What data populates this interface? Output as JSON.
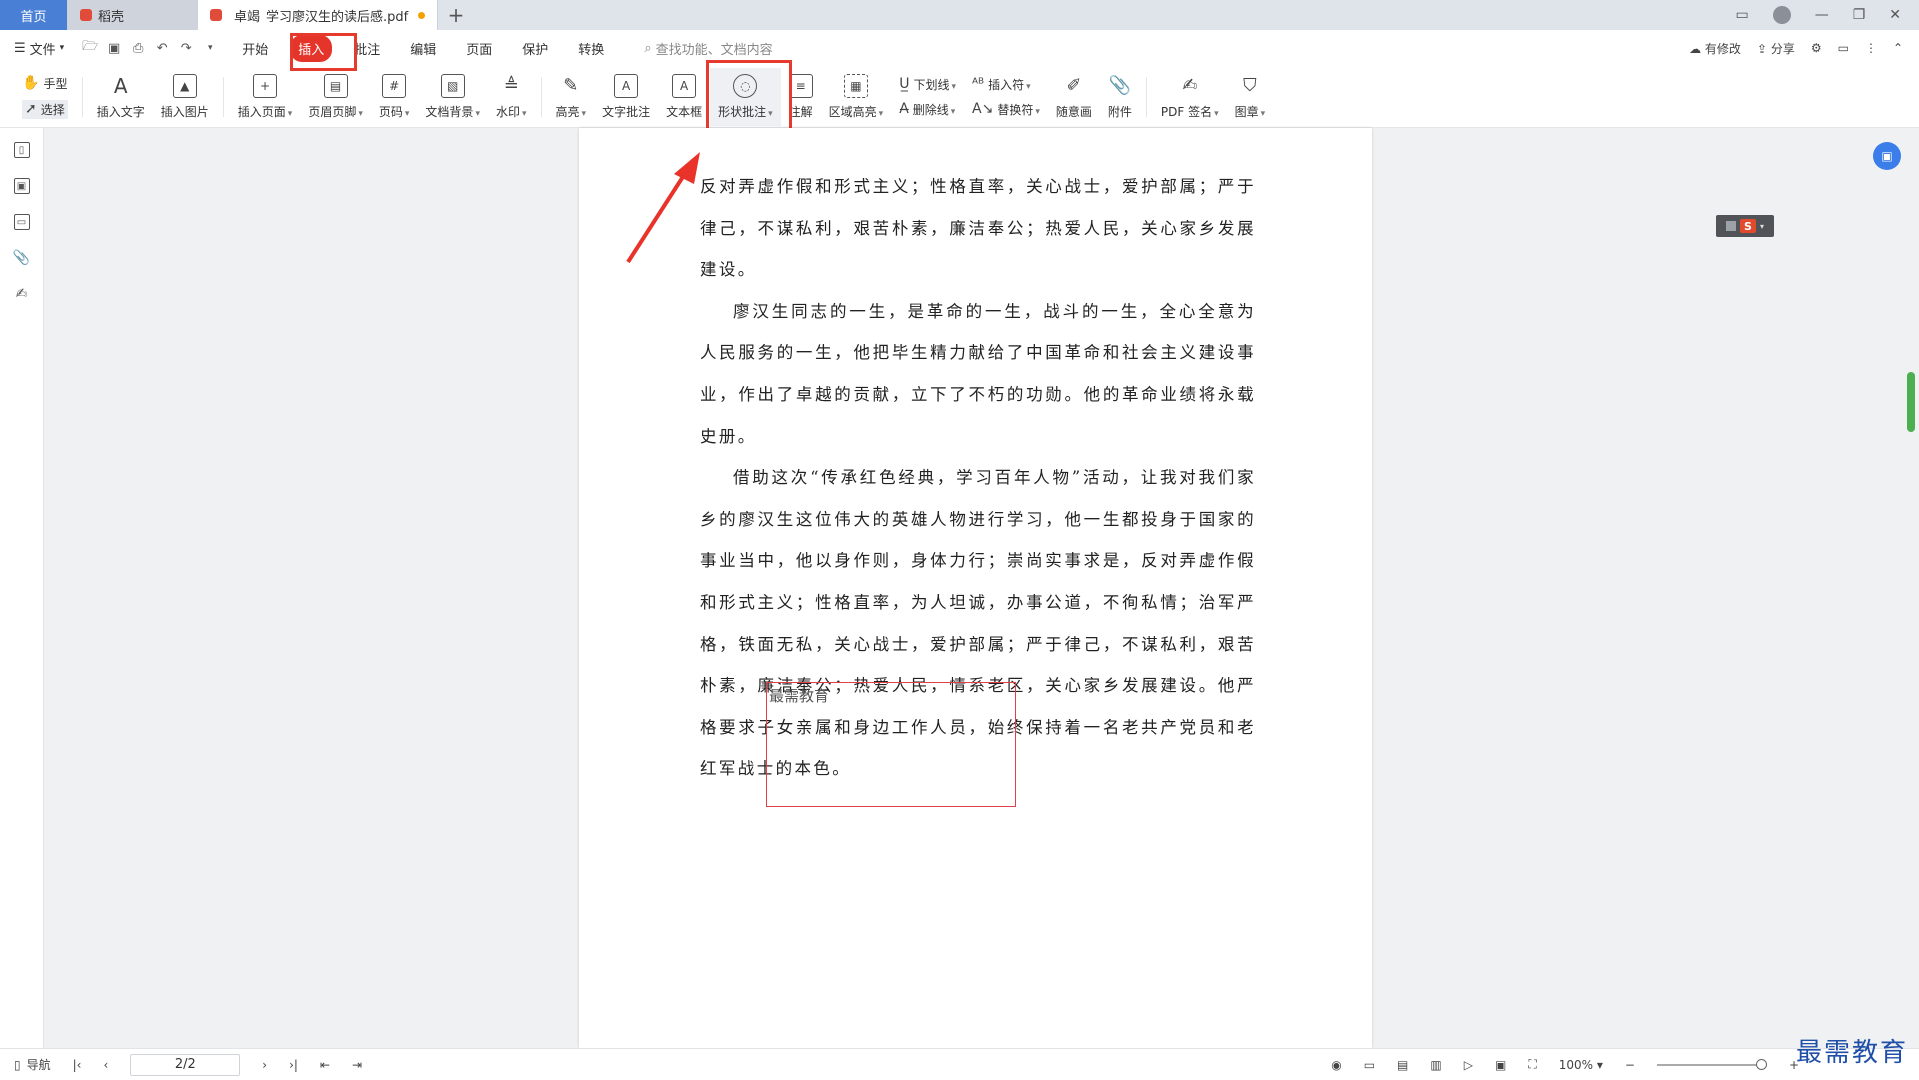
{
  "tabs": {
    "home": "首页",
    "straw": "稻壳",
    "doc_prefix": "卓竭",
    "doc_title": "学习廖汉生的读后感.pdf",
    "plus": "+"
  },
  "menu": {
    "file": "文件",
    "tabs": [
      "开始",
      "插入",
      "批注",
      "编辑",
      "页面",
      "保护",
      "转换"
    ],
    "search_placeholder": "查找功能、文档内容",
    "right": {
      "revise": "有修改",
      "share": "分享"
    }
  },
  "ribbon": {
    "hand": "手型",
    "select": "选择",
    "insert_text": "插入文字",
    "insert_image": "插入图片",
    "insert_page": "插入页面",
    "header_footer": "页眉页脚",
    "page_num": "页码",
    "doc_bg": "文档背景",
    "watermark": "水印",
    "highlight": "高亮",
    "text_comment": "文字批注",
    "textbox": "文本框",
    "shape_comment": "形状批注",
    "note": "注解",
    "area_highlight": "区域高亮",
    "underline": "下划线",
    "strikethrough": "删除线",
    "insert_char": "插入符",
    "replace_char": "替换符",
    "freehand": "随意画",
    "attachment": "附件",
    "pdf_sign": "PDF 签名",
    "stamp": "图章"
  },
  "document": {
    "paragraphs": [
      {
        "indent": false,
        "text": "反对弄虚作假和形式主义；性格直率，关心战士，爱护部属；严于律己，不谋私利，艰苦朴素，廉洁奉公；热爱人民，关心家乡发展建设。"
      },
      {
        "indent": true,
        "text": "廖汉生同志的一生，是革命的一生，战斗的一生，全心全意为人民服务的一生，他把毕生精力献给了中国革命和社会主义建设事业，作出了卓越的贡献，立下了不朽的功勋。他的革命业绩将永载史册。"
      },
      {
        "indent": true,
        "text": "借助这次“传承红色经典，学习百年人物”活动，让我对我们家乡的廖汉生这位伟大的英雄人物进行学习，他一生都投身于国家的事业当中，他以身作则，身体力行；崇尚实事求是，反对弄虚作假和形式主义；性格直率，为人坦诚，办事公道，不徇私情；治军严格，铁面无私，关心战士，爱护部属；严于律己，不谋私利，艰苦朴素，廉洁奉公；热爱人民，情系老区，关心家乡发展建设。他严格要求子女亲属和身边工作人员，始终保持着一名老共产党员和老红军战士的本色。"
      }
    ],
    "annotation_text": "最需教育"
  },
  "status": {
    "nav": "导航",
    "page": "2/2",
    "zoom": "100%"
  },
  "watermark_text": "最需教育",
  "colors": {
    "accent": "#e5352b",
    "brand": "#4a7fd6"
  }
}
